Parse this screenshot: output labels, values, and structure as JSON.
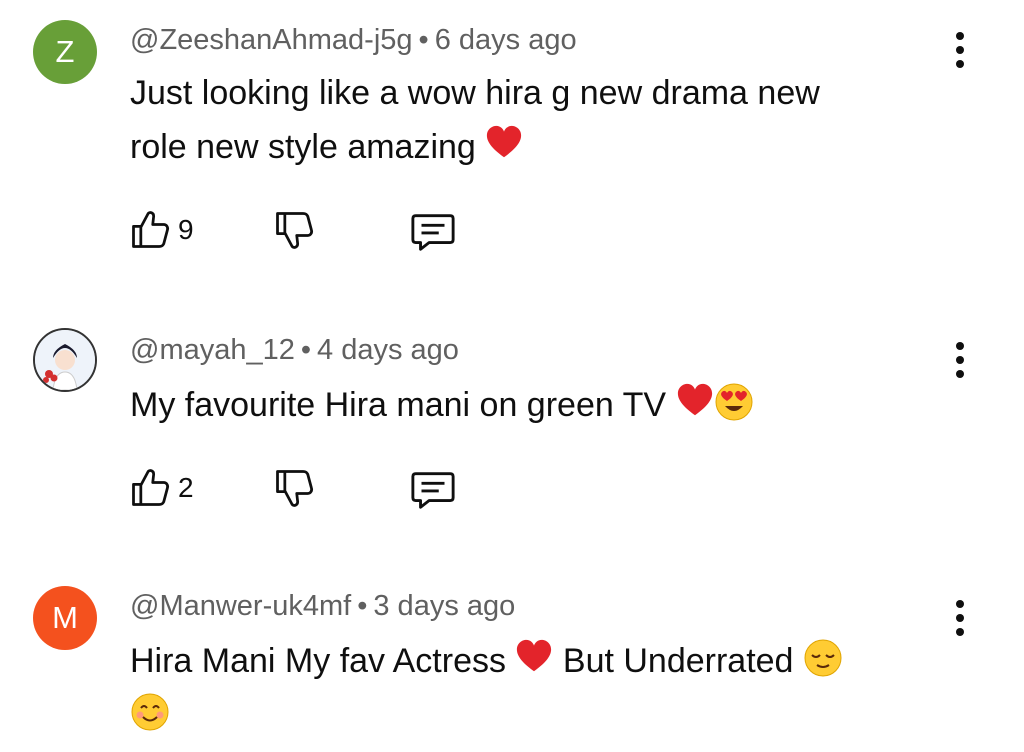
{
  "comments": [
    {
      "avatar_letter": "Z",
      "avatar_color": "#689f38",
      "handle": "@ZeeshanAhmad-j5g",
      "separator": "•",
      "time": "6 days ago",
      "text_line1": "Just looking like a wow hira g new drama new",
      "text_line2": "role new style amazing",
      "likes": "9"
    },
    {
      "avatar_letter": "",
      "avatar_color": "#e8f0f8",
      "handle": "@mayah_12",
      "separator": "•",
      "time": "4 days ago",
      "text_line1": "My favourite Hira mani on green TV",
      "likes": "2"
    },
    {
      "avatar_letter": "M",
      "avatar_color": "#f4511e",
      "handle": "@Manwer-uk4mf",
      "separator": "•",
      "time": "3 days ago",
      "text_part1": "Hira Mani My fav Actress",
      "text_part2": "But Underrated"
    }
  ],
  "icons": {
    "like": "thumbs-up-icon",
    "dislike": "thumbs-down-icon",
    "reply": "reply-comment-icon",
    "more": "more-vertical-icon"
  }
}
